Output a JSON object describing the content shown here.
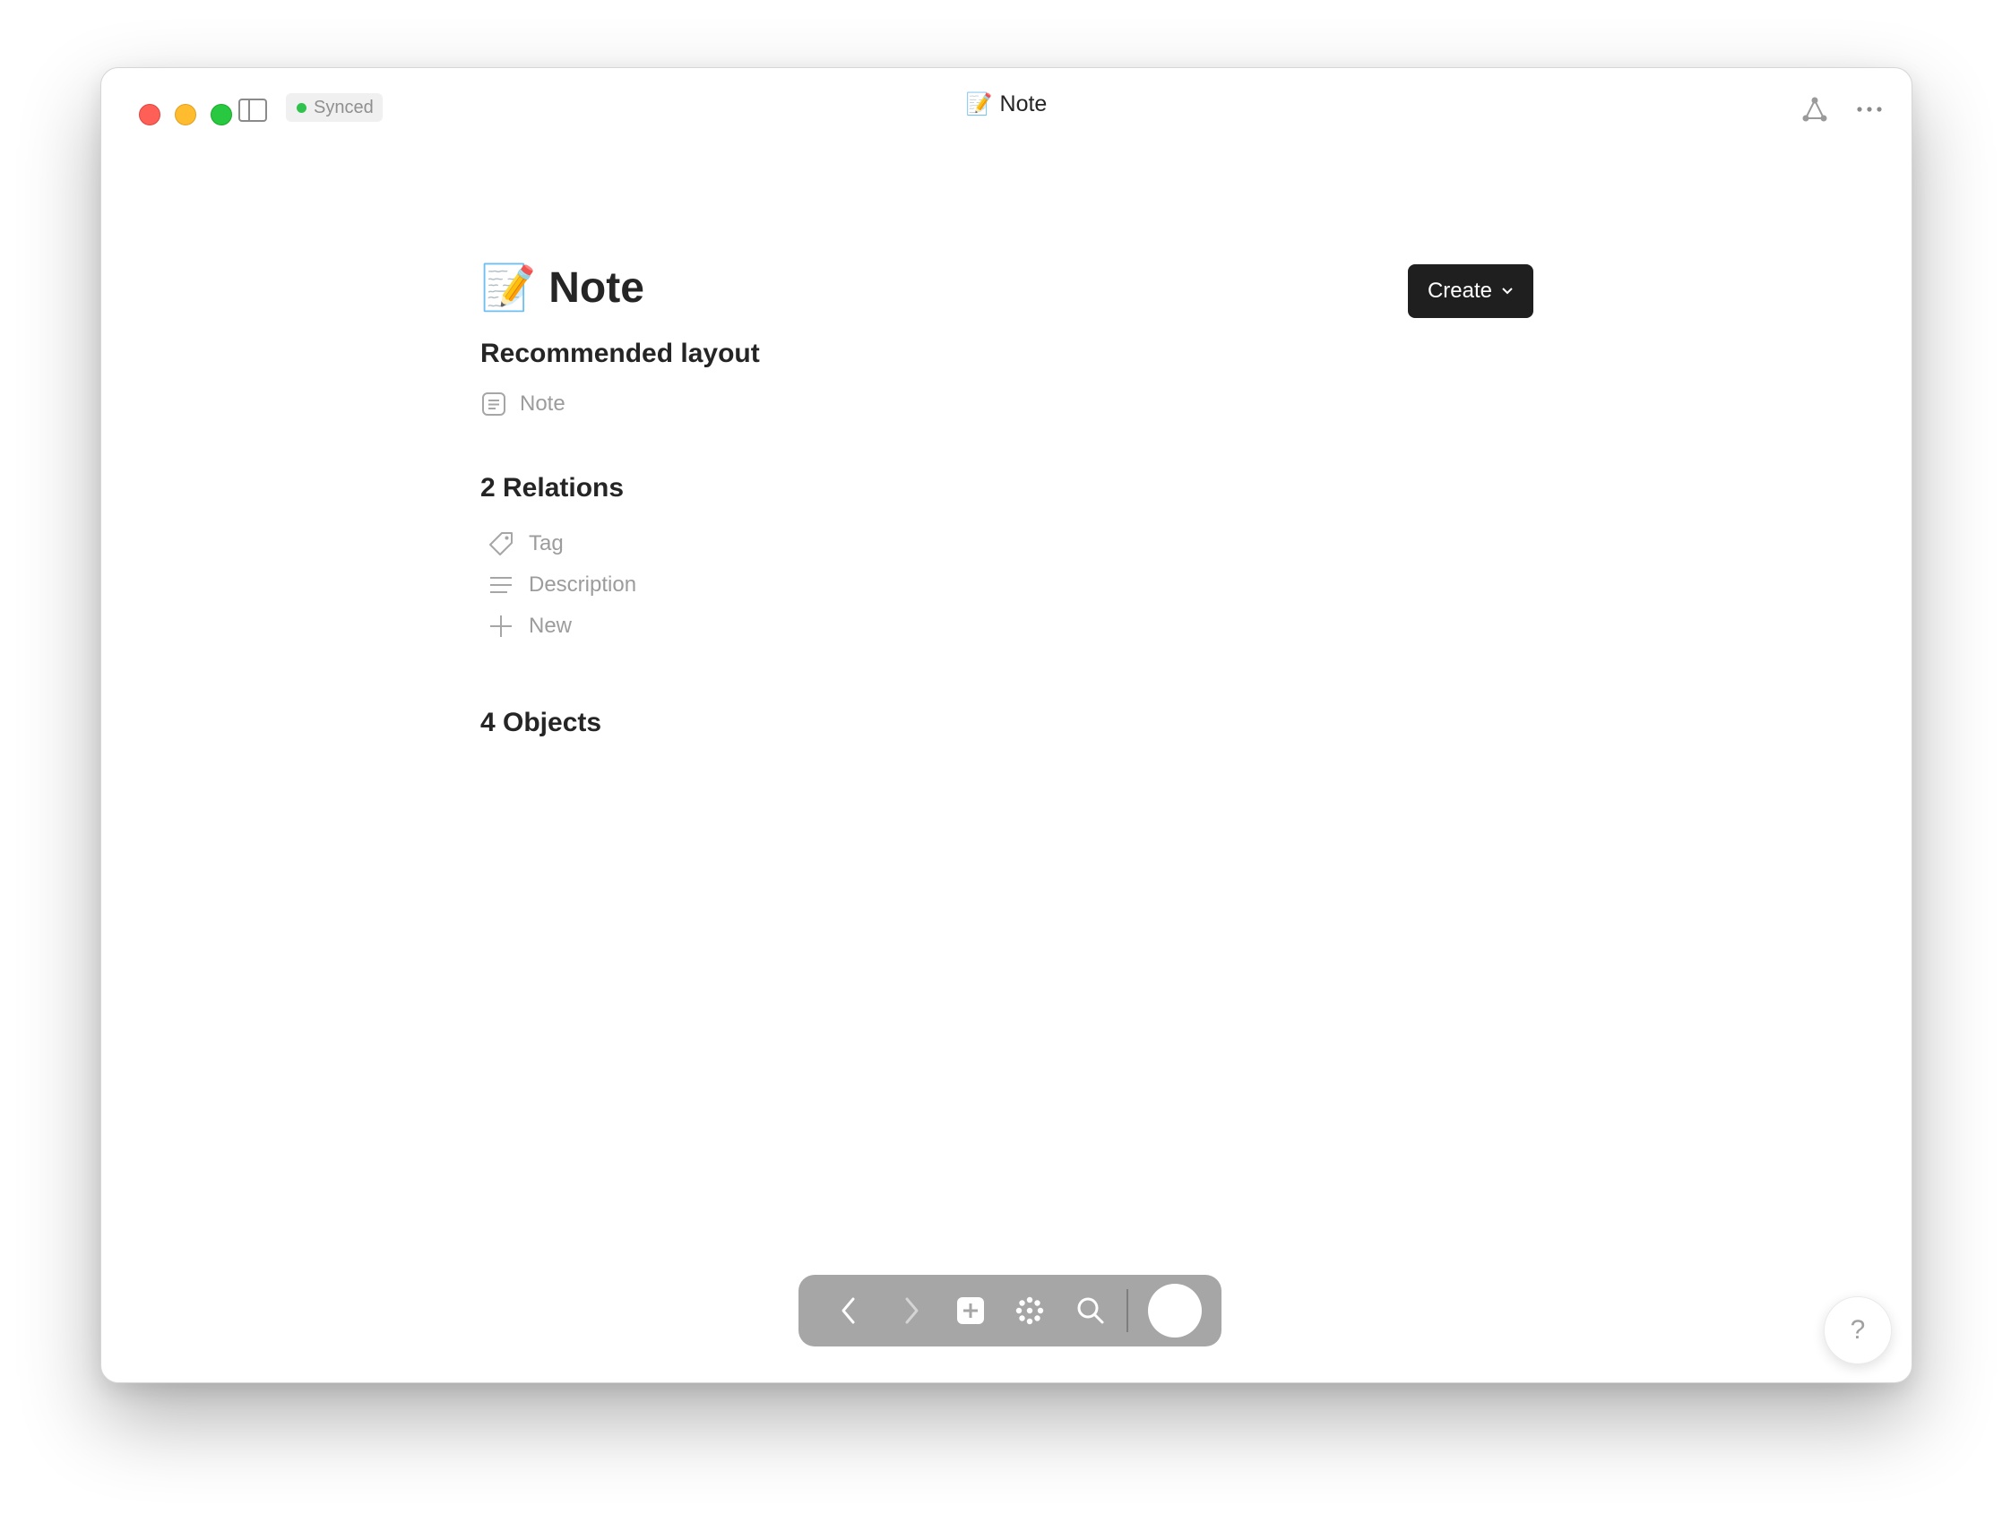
{
  "titlebar": {
    "sync_status": "Synced",
    "title_emoji": "📝",
    "title": "Note"
  },
  "page": {
    "emoji": "📝",
    "title": "Note",
    "create_label": "Create"
  },
  "layout_section": {
    "heading": "Recommended layout",
    "item_label": "Note"
  },
  "relations_section": {
    "heading": "2 Relations",
    "items": [
      {
        "label": "Tag",
        "icon": "tag-icon"
      },
      {
        "label": "Description",
        "icon": "lines-icon"
      },
      {
        "label": "New",
        "icon": "plus-icon"
      }
    ]
  },
  "objects_section": {
    "heading": "4 Objects"
  },
  "help": {
    "label": "?"
  },
  "colors": {
    "sync_dot": "#2fc34e",
    "create_bg": "#1f1f1f",
    "nav_bg": "#a6a6a6"
  }
}
